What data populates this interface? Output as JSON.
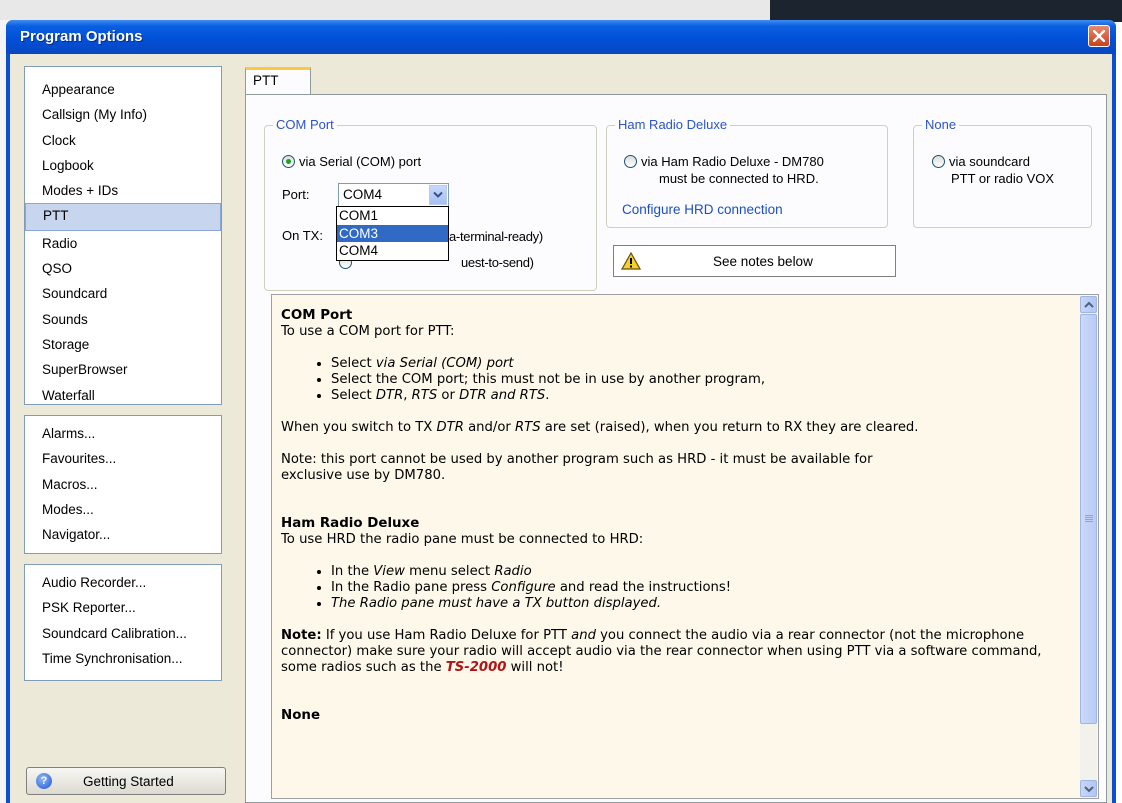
{
  "window": {
    "title": "Program Options"
  },
  "nav": {
    "group1": [
      "Appearance",
      "Callsign (My Info)",
      "Clock",
      "Logbook",
      "Modes + IDs",
      "PTT",
      "Radio",
      "QSO",
      "Soundcard",
      "Sounds",
      "Storage",
      "SuperBrowser",
      "Waterfall"
    ],
    "selected": "PTT",
    "group2": [
      "Alarms...",
      "Favourites...",
      "Macros...",
      "Modes...",
      "Navigator..."
    ],
    "group3": [
      "Audio Recorder...",
      "PSK Reporter...",
      "Soundcard Calibration...",
      "Time Synchronisation..."
    ],
    "getting_started": "Getting Started"
  },
  "tab": {
    "label": "PTT"
  },
  "com_port": {
    "legend": "COM Port",
    "radio_label": "via Serial (COM) port",
    "port_label": "Port:",
    "port_value": "COM4",
    "options": [
      "COM1",
      "COM3",
      "COM4"
    ],
    "highlighted": "COM3",
    "ontx_label": "On TX:",
    "dtr_tail": "a-terminal-ready)",
    "rts_tail": "uest-to-send)"
  },
  "hrd": {
    "legend": "Ham Radio Deluxe",
    "radio_line1": "via Ham Radio Deluxe - DM780",
    "radio_line2": "must be connected to HRD.",
    "link": "Configure HRD connection"
  },
  "none": {
    "legend": "None",
    "radio_line1": "via soundcard",
    "radio_line2": "PTT or radio VOX"
  },
  "notes_button": {
    "label": "See notes below"
  },
  "notes": {
    "com_heading": "COM Port",
    "com_intro": "To use a COM port for PTT:",
    "com_b1_pre": "Select ",
    "com_b1_em": "via Serial (COM) port",
    "com_b2": "Select the COM port; this must not be in use by another program,",
    "com_b3_pre": "Select ",
    "com_b3_em1": "DTR",
    "com_b3_mid1": ", ",
    "com_b3_em2": "RTS",
    "com_b3_mid2": " or ",
    "com_b3_em3": "DTR and RTS",
    "com_b3_end": ".",
    "switch_pre": "When you switch to TX ",
    "switch_em1": "DTR",
    "switch_mid": " and/or ",
    "switch_em2": "RTS",
    "switch_end": " are set (raised), when you return to RX they are cleared.",
    "note_line1": "Note: this port cannot be used by another program such as HRD - it must be available for",
    "note_line2": "exclusive use by DM780.",
    "hrd_heading": "Ham Radio Deluxe",
    "hrd_intro": "To use HRD the radio pane must be connected to HRD:",
    "hrd_b1_pre": "In the ",
    "hrd_b1_em1": "View",
    "hrd_b1_mid": " menu select ",
    "hrd_b1_em2": "Radio",
    "hrd_b2_pre": "In the Radio pane press ",
    "hrd_b2_em": "Configure",
    "hrd_b2_end": " and read the instructions!",
    "hrd_b3": "The Radio pane must have a TX button displayed.",
    "note2_bold": "Note:",
    "note2_a": " If you use Ham Radio Deluxe for PTT ",
    "note2_and": "and",
    "note2_b": " you connect the audio via a rear connector (not the microphone connector) make sure your radio will accept audio via the rear connector when using PTT via a software command, some radios such as the ",
    "note2_red": "TS-2000",
    "note2_c": " will not!",
    "none_heading": "None"
  }
}
